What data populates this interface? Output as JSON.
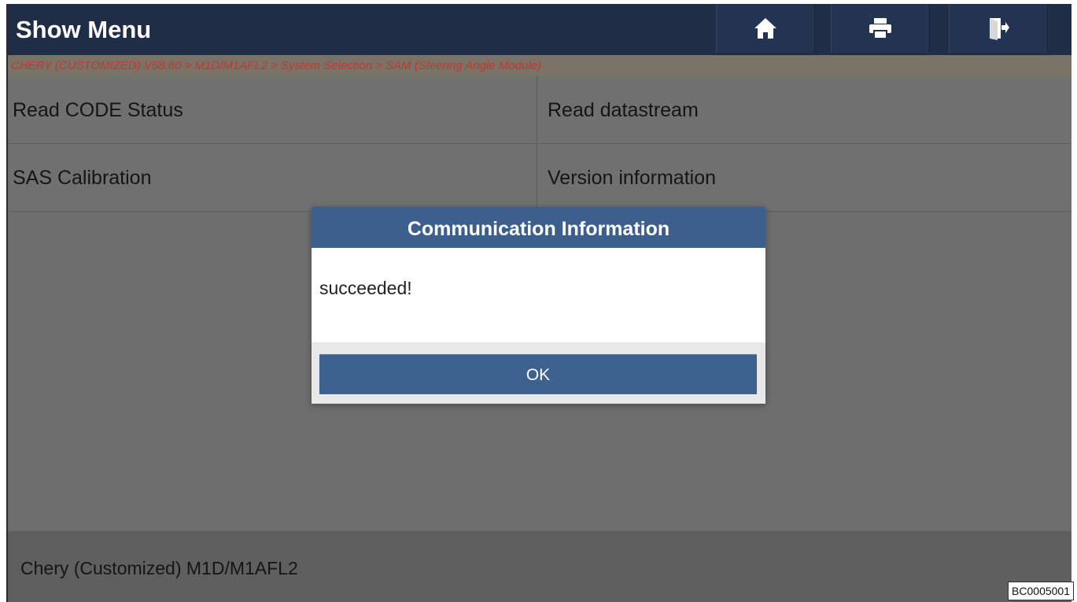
{
  "header": {
    "title": "Show Menu",
    "buttons": {
      "home_icon": "home-icon",
      "print_icon": "print-icon",
      "exit_icon": "exit-icon"
    }
  },
  "breadcrumb": "CHERY (CUSTOMIZED) V58.60 > M1D/M1AFL2 > System Selection > SAM (Steering Angle Module)",
  "menu": {
    "items": [
      {
        "label": "Read CODE Status"
      },
      {
        "label": "Read datastream"
      },
      {
        "label": "SAS Calibration"
      },
      {
        "label": "Version information"
      }
    ]
  },
  "dialog": {
    "title": "Communication Information",
    "message": "succeeded!",
    "ok_label": "OK"
  },
  "footer": {
    "vehicle": "Chery (Customized) M1D/M1AFL2"
  },
  "code_label": "BC0005001",
  "colors": {
    "header_bg": "#1f2d46",
    "breadcrumb_text": "#c0392b",
    "dialog_accent": "#3c5f8d"
  }
}
